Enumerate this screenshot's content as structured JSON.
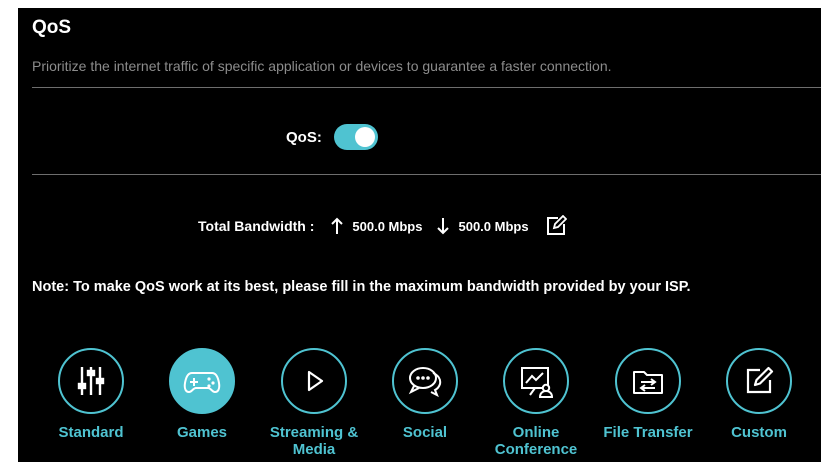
{
  "header": {
    "title": "QoS",
    "subtitle": "Prioritize the internet traffic of specific application or devices to guarantee a faster connection."
  },
  "qos": {
    "label": "QoS:",
    "enabled": true
  },
  "bandwidth": {
    "label": "Total Bandwidth :",
    "upload": "500.0 Mbps",
    "download": "500.0 Mbps"
  },
  "note": "Note: To make QoS work at its best, please fill in the maximum bandwidth provided by your ISP.",
  "categories": [
    {
      "label": "Standard",
      "icon": "sliders-icon"
    },
    {
      "label": "Games",
      "icon": "gamepad-icon",
      "selected": true
    },
    {
      "label": "Streaming & Media",
      "icon": "play-icon"
    },
    {
      "label": "Social",
      "icon": "chat-bubbles-icon"
    },
    {
      "label": "Online Conference",
      "icon": "presentation-icon"
    },
    {
      "label": "File Transfer",
      "icon": "folder-transfer-icon"
    },
    {
      "label": "Custom",
      "icon": "edit-icon"
    }
  ],
  "colors": {
    "accent": "#4fc3d1",
    "background": "#000000",
    "muted_text": "#8c8c8c"
  }
}
